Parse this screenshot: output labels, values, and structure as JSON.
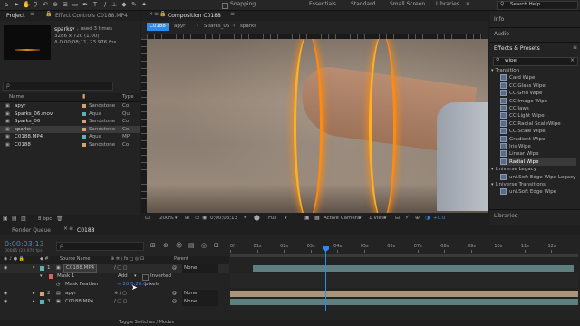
{
  "toolbar": {
    "snapping": "Snapping",
    "workspaces": [
      "Essentials",
      "Standard",
      "Small Screen",
      "Libraries"
    ],
    "search_placeholder": "Search Help"
  },
  "project_panel": {
    "tab_project": "Project",
    "tab_effect_controls": "Effect Controls C0188.MP4",
    "item_name": "sparks",
    "item_used": ", used 3 times",
    "item_size": "3286 x 720 (1.00)",
    "item_duration": "Δ 0;00;08;11, 23.976 fps",
    "search_placeholder": "ρ",
    "col_name": "Name",
    "col_type": "Type",
    "items": [
      {
        "name": "apyr",
        "label": "Sandstone",
        "type": "Co",
        "color": "#d4a373"
      },
      {
        "name": "Sparks_06.mov",
        "label": "Aqua",
        "type": "Qu",
        "color": "#5ab4b4"
      },
      {
        "name": "Sparks_06",
        "label": "Sandstone",
        "type": "Co",
        "color": "#d4a373"
      },
      {
        "name": "sparks",
        "label": "Sandstone",
        "type": "Co",
        "color": "#d4a373"
      },
      {
        "name": "C0188.MP4",
        "label": "Aqua",
        "type": "MP",
        "color": "#5ab4b4"
      },
      {
        "name": "C0188",
        "label": "Sandstone",
        "type": "Co",
        "color": "#d4a373"
      }
    ],
    "bpc": "8 bpc"
  },
  "composition": {
    "title": "Composition C0188",
    "breadcrumbs": [
      "C0188",
      "apyr",
      "Sparks_06",
      "sparks"
    ],
    "zoom": "200%",
    "timecode": "0;00;03;13",
    "resolution": "Full",
    "camera": "Active Camera",
    "view": "1 View",
    "exposure": "+0.0"
  },
  "right_panel": {
    "info": "Info",
    "audio": "Audio",
    "effects_title": "Effects & Presets",
    "search_value": "wipe",
    "categories": [
      {
        "name": "Transition",
        "items": [
          "Card Wipe",
          "CC Glass Wipe",
          "CC Grid Wipe",
          "CC Image Wipe",
          "CC Jaws",
          "CC Light Wipe",
          "CC Radial ScaleWipe",
          "CC Scale Wipe",
          "Gradient Wipe",
          "Iris Wipe",
          "Linear Wipe",
          "Radial Wipe"
        ]
      },
      {
        "name": "Universe Legacy",
        "items": [
          "uni.Soft Edge Wipe Legacy"
        ]
      },
      {
        "name": "Universe Transitions",
        "items": [
          "uni.Soft Edge Wipe"
        ]
      }
    ],
    "selected_effect": "Radial Wipe",
    "libraries": "Libraries"
  },
  "timeline": {
    "render_queue": "Render Queue",
    "comp_tab": "C0188",
    "timecode": "0:00:03:13",
    "fps_info": "00085 (23.976 fps)",
    "search_placeholder": "ρ",
    "col_source": "Source Name",
    "col_parent": "Parent",
    "ruler": [
      "0f",
      "01s",
      "02s",
      "03s",
      "04s",
      "05s",
      "06s",
      "07s",
      "08s",
      "09s",
      "10s",
      "11s",
      "12s"
    ],
    "layers": [
      {
        "num": "1",
        "name": "C0188.MP4",
        "parent": "None",
        "color": "#5ab4b4"
      },
      {
        "num": "2",
        "name": "apyr",
        "parent": "None",
        "color": "#d4a373"
      },
      {
        "num": "3",
        "name": "C0188.MP4",
        "parent": "None",
        "color": "#5ab4b4"
      }
    ],
    "mask_name": "Mask 1",
    "mask_mode": "Add",
    "mask_inverted": "Inverted",
    "mask_feather_label": "Mask Feather",
    "mask_feather_value": "∞ 20.0,20.0",
    "mask_feather_unit": "pixels",
    "footer": "Toggle Switches / Modes"
  },
  "colors": {
    "accent": "#2d8ceb",
    "timecode": "#3e8bd8",
    "track_teal": "#5d7f7f",
    "track_tan": "#a8957a"
  }
}
